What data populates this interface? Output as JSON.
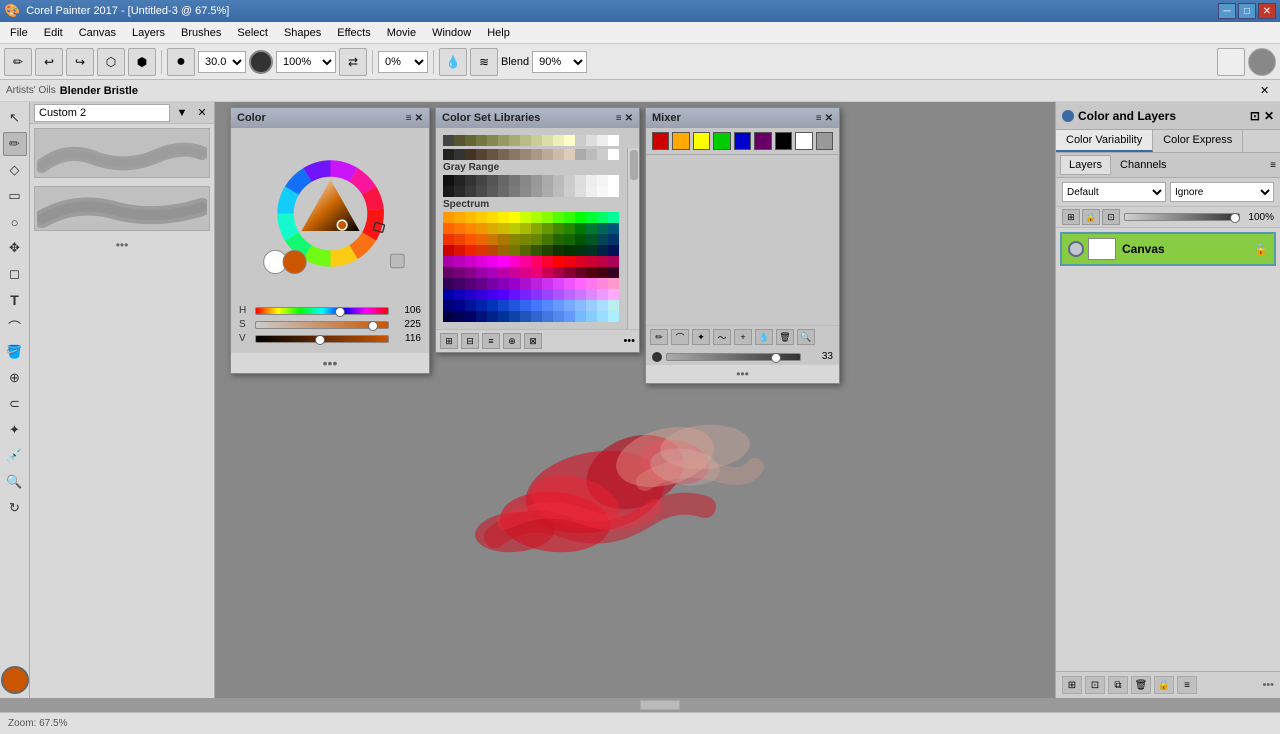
{
  "titlebar": {
    "title": "Corel Painter 2017 - [Untitled-3 @ 67.5%]",
    "min_btn": "─",
    "max_btn": "□",
    "close_btn": "✕"
  },
  "menu": {
    "items": [
      "File",
      "Edit",
      "Canvas",
      "Layers",
      "Brushes",
      "Select",
      "Shapes",
      "Effects",
      "Movie",
      "Window",
      "Help"
    ]
  },
  "toolbar": {
    "brush_size": "30.0",
    "opacity": "100%",
    "blend_label": "Blend",
    "blend_value": "90%",
    "opacity_value": "0%"
  },
  "brush_panel": {
    "header": "Custom 2",
    "brush_type": "Artists' Oils",
    "brush_name": "Blender Bristle"
  },
  "color_panel": {
    "title": "Color",
    "h_label": "H",
    "s_label": "S",
    "v_label": "V",
    "h_value": "106",
    "s_value": "225",
    "v_value": "116",
    "h_percent": "60",
    "s_percent": "88",
    "v_percent": "45",
    "dots": "•••"
  },
  "colorset_panel": {
    "title": "Color Set Libraries",
    "gray_range_label": "Gray Range",
    "spectrum_label": "Spectrum",
    "dots": "•••"
  },
  "mixer_panel": {
    "title": "Mixer",
    "slider_value": "33",
    "dots": "•••"
  },
  "color_and_layers": {
    "title": "Color and Layers",
    "color_variability_tab": "Color Variability",
    "color_express_tab": "Color Express",
    "layers_tab": "Layers",
    "channels_tab": "Channels",
    "default_label": "Default",
    "ignore_label": "Ignore",
    "opacity_value": "100%",
    "canvas_layer_label": "Canvas",
    "dots": "•••"
  },
  "status_bar": {
    "zoom": "67.5%"
  },
  "colors": {
    "accent_blue": "#3a6aa5",
    "canvas_layer_green": "#88cc44",
    "active_color": "#cc5500"
  }
}
